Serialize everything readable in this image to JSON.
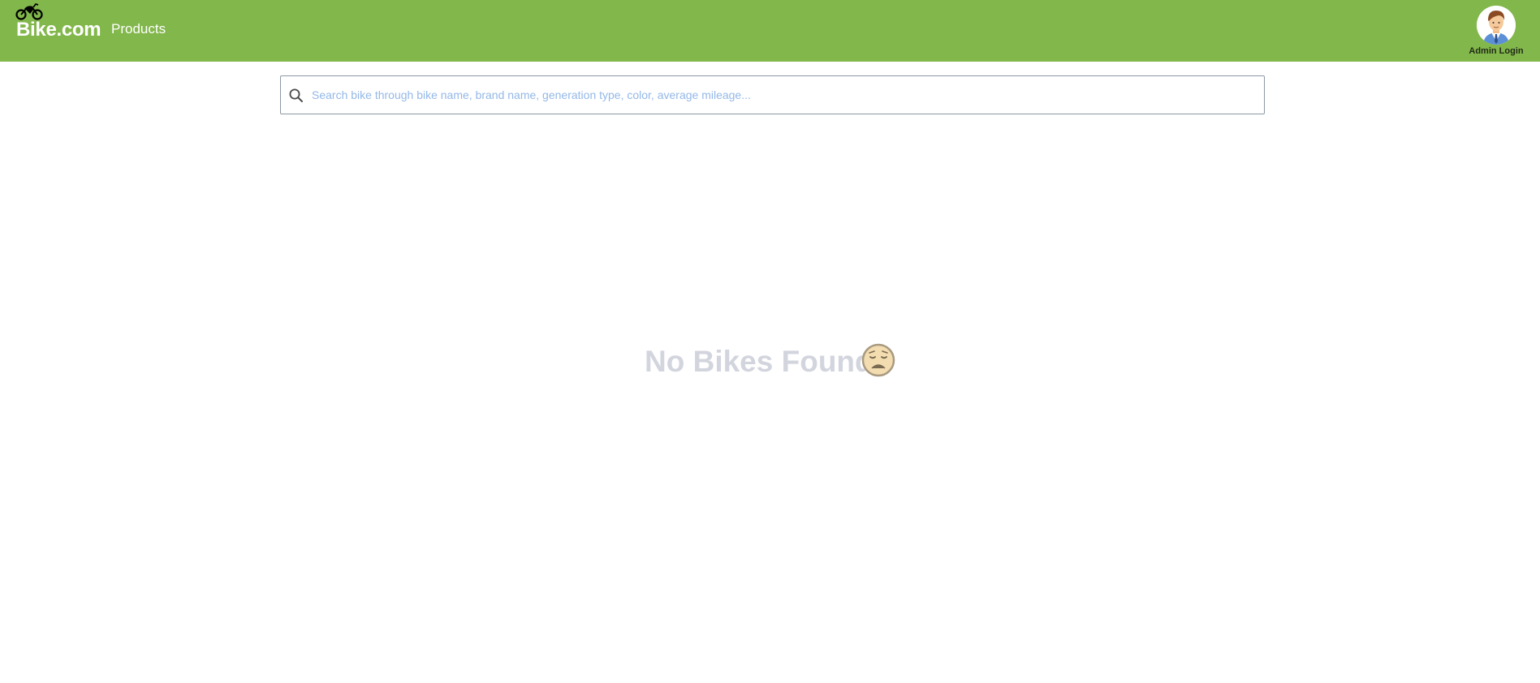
{
  "header": {
    "brand": "Bike.com",
    "brand_icon": "motorcycle-icon",
    "nav_products": "Products",
    "admin_label": "Admin Login",
    "admin_icon": "admin-avatar-icon",
    "background_color": "#82b74b"
  },
  "search": {
    "placeholder": "Search bike through bike name, brand name, generation type, color, average mileage...",
    "value": "",
    "icon": "search-icon"
  },
  "main": {
    "empty_message": "No Bikes Found",
    "empty_icon": "sad-face-icon"
  }
}
